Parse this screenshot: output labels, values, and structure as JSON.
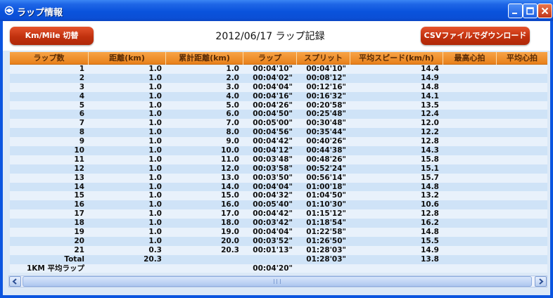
{
  "window": {
    "title": "ラップ情報"
  },
  "toolbar": {
    "unit_toggle_label": "Km/Mile 切替",
    "page_title": "2012/06/17 ラップ記録",
    "csv_download_label": "CSVファイルでダウンロード"
  },
  "table": {
    "columns": [
      "ラップ数",
      "距離(km)",
      "累計距離(km)",
      "ラップ",
      "スプリット",
      "平均スピード(km/h)",
      "最高心拍",
      "平均心拍"
    ],
    "rows": [
      [
        "1",
        "1.0",
        "1.0",
        "00:04'10\"",
        "00:04'10\"",
        "14.4",
        "",
        ""
      ],
      [
        "2",
        "1.0",
        "2.0",
        "00:04'02\"",
        "00:08'12\"",
        "14.9",
        "",
        ""
      ],
      [
        "3",
        "1.0",
        "3.0",
        "00:04'04\"",
        "00:12'16\"",
        "14.8",
        "",
        ""
      ],
      [
        "4",
        "1.0",
        "4.0",
        "00:04'16\"",
        "00:16'32\"",
        "14.1",
        "",
        ""
      ],
      [
        "5",
        "1.0",
        "5.0",
        "00:04'26\"",
        "00:20'58\"",
        "13.5",
        "",
        ""
      ],
      [
        "6",
        "1.0",
        "6.0",
        "00:04'50\"",
        "00:25'48\"",
        "12.4",
        "",
        ""
      ],
      [
        "7",
        "1.0",
        "7.0",
        "00:05'00\"",
        "00:30'48\"",
        "12.0",
        "",
        ""
      ],
      [
        "8",
        "1.0",
        "8.0",
        "00:04'56\"",
        "00:35'44\"",
        "12.2",
        "",
        ""
      ],
      [
        "9",
        "1.0",
        "9.0",
        "00:04'42\"",
        "00:40'26\"",
        "12.8",
        "",
        ""
      ],
      [
        "10",
        "1.0",
        "10.0",
        "00:04'12\"",
        "00:44'38\"",
        "14.3",
        "",
        ""
      ],
      [
        "11",
        "1.0",
        "11.0",
        "00:03'48\"",
        "00:48'26\"",
        "15.8",
        "",
        ""
      ],
      [
        "12",
        "1.0",
        "12.0",
        "00:03'58\"",
        "00:52'24\"",
        "15.1",
        "",
        ""
      ],
      [
        "13",
        "1.0",
        "13.0",
        "00:03'50\"",
        "00:56'14\"",
        "15.7",
        "",
        ""
      ],
      [
        "14",
        "1.0",
        "14.0",
        "00:04'04\"",
        "01:00'18\"",
        "14.8",
        "",
        ""
      ],
      [
        "15",
        "1.0",
        "15.0",
        "00:04'32\"",
        "01:04'50\"",
        "13.2",
        "",
        ""
      ],
      [
        "16",
        "1.0",
        "16.0",
        "00:05'40\"",
        "01:10'30\"",
        "10.6",
        "",
        ""
      ],
      [
        "17",
        "1.0",
        "17.0",
        "00:04'42\"",
        "01:15'12\"",
        "12.8",
        "",
        ""
      ],
      [
        "18",
        "1.0",
        "18.0",
        "00:03'42\"",
        "01:18'54\"",
        "16.2",
        "",
        ""
      ],
      [
        "19",
        "1.0",
        "19.0",
        "00:04'04\"",
        "01:22'58\"",
        "14.8",
        "",
        ""
      ],
      [
        "20",
        "1.0",
        "20.0",
        "00:03'52\"",
        "01:26'50\"",
        "15.5",
        "",
        ""
      ],
      [
        "21",
        "0.3",
        "20.3",
        "00:01'13\"",
        "01:28'03\"",
        "14.9",
        "",
        ""
      ],
      [
        "Total",
        "20.3",
        "",
        "",
        "01:28'03\"",
        "13.8",
        "",
        ""
      ],
      [
        "1KM 平均ラップ",
        "",
        "",
        "00:04'20\"",
        "",
        "",
        "",
        ""
      ]
    ]
  },
  "scrollbar": {
    "grip_label": "III"
  },
  "colors": {
    "accent": "#c1310e",
    "header": "#f7a447",
    "titlebar": "#0a53dc"
  }
}
